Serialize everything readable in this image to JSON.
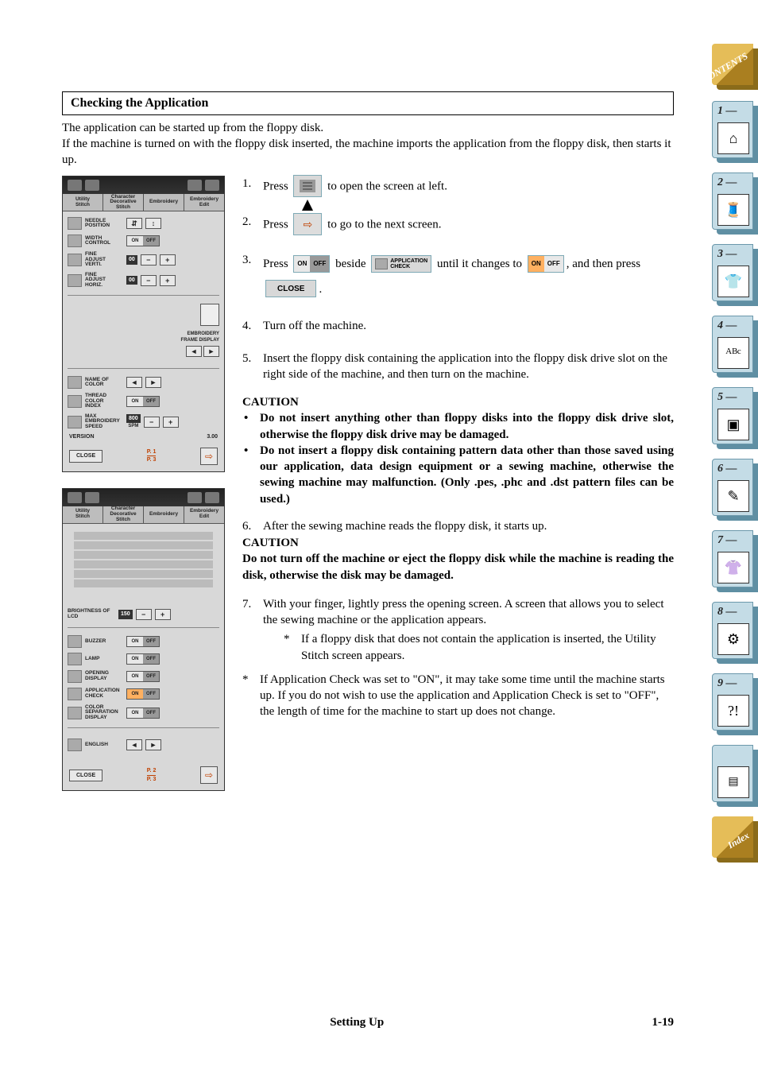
{
  "header": {
    "title": "Checking the Application"
  },
  "intro": {
    "line1": "The application can be started up from the floppy disk.",
    "line2": "If the machine is turned on with the floppy disk inserted, the machine imports the application from the floppy disk, then starts it up."
  },
  "lcd1": {
    "tabs": [
      "Utility\nStitch",
      "Character\nDecorative\nStitch",
      "Embroidery",
      "Embroidery\nEdit"
    ],
    "rows": {
      "needle": "NEEDLE\nPOSITION",
      "width": "WIDTH\nCONTROL",
      "fine_v": "FINE\nADJUST\nVERTI.",
      "fine_v_val": "00",
      "fine_h": "FINE\nADJUST\nHORIZ.",
      "fine_h_val": "00",
      "emb_frame": "EMBROIDERY\nFRAME DISPLAY",
      "name_color": "NAME OF\nCOLOR",
      "thread_color": "THREAD\nCOLOR\nINDEX",
      "max_speed": "MAX\nEMBROIDERY\nSPEED",
      "max_speed_val": "800",
      "max_speed_unit": "SPM"
    },
    "version_label": "VERSION",
    "version_value": "3.00",
    "close": "CLOSE",
    "pager_top": "P. 1",
    "pager_bot": "P. 3",
    "on": "ON",
    "off": "OFF"
  },
  "lcd2": {
    "tabs": [
      "Utility\nStitch",
      "Character\nDecorative\nStitch",
      "Embroidery",
      "Embroidery\nEdit"
    ],
    "rows": {
      "brightness": "BRIGHTNESS OF\nLCD",
      "brightness_val": "150",
      "buzzer": "BUZZER",
      "lamp": "LAMP",
      "opening": "OPENING\nDISPLAY",
      "appcheck": "APPLICATION\nCHECK",
      "colorsep": "COLOR\nSEPARATION\nDISPLAY",
      "language": "ENGLISH"
    },
    "close": "CLOSE",
    "pager_top": "P. 2",
    "pager_bot": "P. 3",
    "on": "ON",
    "off": "OFF"
  },
  "steps": {
    "s1a": "Press",
    "s1b": "to open the screen at left.",
    "s2a": "Press",
    "s2b": "to go to the next screen.",
    "s3a": "Press",
    "s3b": "beside",
    "s3_appcheck": "APPLICATION\nCHECK",
    "s3c": "until it changes to",
    "s3d": ", and then press",
    "s3_close": "CLOSE",
    "s3e": ".",
    "s4": "Turn off the machine.",
    "s5": "Insert the floppy disk containing the application into the floppy disk drive slot on the right side of the machine, and then turn on the machine.",
    "s6": "After the sewing machine reads the floppy disk, it starts up.",
    "s7": "With your finger, lightly press the opening screen. A screen that allows you to select the sewing machine or the application appears.",
    "s7_sub": "If a floppy disk that does not contain the application is inserted, the Utility Stitch screen appears.",
    "on": "ON",
    "off": "OFF"
  },
  "caution1": {
    "heading": "CAUTION",
    "c1": "Do not insert anything other than floppy disks into the floppy disk drive slot, otherwise the floppy disk drive may be damaged.",
    "c2": "Do not insert a floppy disk containing pattern data other than those saved using our application, data design equipment or a sewing machine, otherwise the sewing machine may malfunction. (Only .pes, .phc and .dst pattern files can be used.)"
  },
  "caution2": {
    "heading": "CAUTION",
    "text": "Do not turn off the machine or eject the floppy disk while the machine is reading the disk, otherwise the disk may be damaged."
  },
  "bottom_note": "If Application Check was set to \"ON\", it may take some time until the machine starts up. If you do not wish to use the application and Application Check is set to \"OFF\", the length of time for the machine to start up does not change.",
  "footer": {
    "center": "Setting Up",
    "right": "1-19"
  },
  "sidetabs": {
    "contents": "CONTENTS",
    "t1": "1 —",
    "t2": "2 —",
    "t3": "3 —",
    "t4": "4 —",
    "t5": "5 —",
    "t6": "6 —",
    "t7": "7 —",
    "t8": "8 —",
    "t9": "9 —",
    "index": "Index"
  }
}
